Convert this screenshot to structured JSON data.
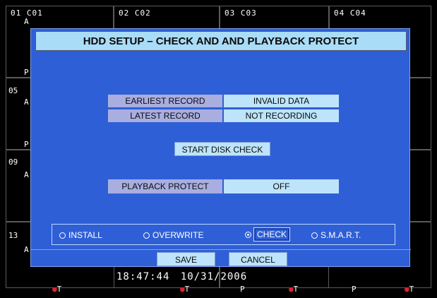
{
  "cameras": [
    {
      "label": "01 C01"
    },
    {
      "label": "02 C02"
    },
    {
      "label": "03 C03"
    },
    {
      "label": "04 C04"
    }
  ],
  "side_labels": {
    "r1_a": "A",
    "r1_p": "P",
    "r2_num": "05",
    "r2_a": "A",
    "r2_p": "P",
    "r3_num": "09",
    "r3_a": "A",
    "r4_num": "13",
    "r4_a": "A"
  },
  "bottom_flags": [
    "T",
    "T",
    "P",
    "T",
    "P",
    "T"
  ],
  "dialog": {
    "title": "HDD SETUP – CHECK AND  AND PLAYBACK PROTECT",
    "rows": [
      {
        "label": "EARLIEST RECORD",
        "value": "INVALID DATA"
      },
      {
        "label": "LATEST RECORD",
        "value": "NOT RECORDING"
      }
    ],
    "start_disk_check": "START DISK CHECK",
    "playback_protect_label": "PLAYBACK PROTECT",
    "playback_protect_value": "OFF",
    "radios": [
      {
        "label": "INSTALL",
        "selected": false
      },
      {
        "label": "OVERWRITE",
        "selected": false
      },
      {
        "label": "CHECK",
        "selected": true
      },
      {
        "label": "S.M.A.R.T.",
        "selected": false
      }
    ],
    "save_label": "SAVE",
    "cancel_label": "CANCEL"
  },
  "status": {
    "time": "18:47:44",
    "date": "10/31/2006"
  },
  "colors": {
    "dialog_bg": "#2f5fd6",
    "title_bg": "#a9dcf7",
    "label_bg": "#a9aee0",
    "value_bg": "#bde4fa",
    "record_dot": "#e0202a"
  }
}
